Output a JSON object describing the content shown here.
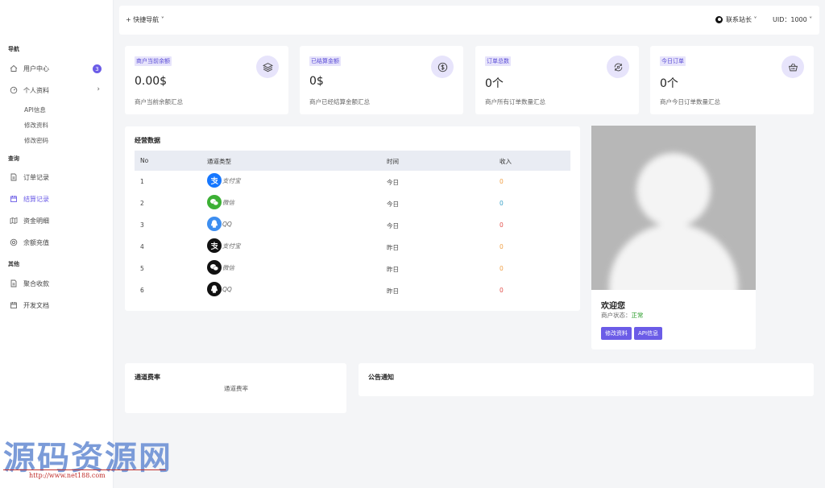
{
  "sidebar": {
    "section_nav": "导航",
    "user_center": "用户中心",
    "user_center_badge": "3",
    "profile": "个人资料",
    "profile_arrow": "›",
    "sub_api": "API信息",
    "sub_edit": "修改资料",
    "sub_pwd": "修改密码",
    "section_query": "查询",
    "orders": "订单记录",
    "settlements": "结算记录",
    "funds": "资金明细",
    "recharge": "余额充值",
    "section_other": "其他",
    "aggregate": "聚合收款",
    "docs": "开发文档"
  },
  "topbar": {
    "quicknav": "+ 快捷导航 ˅",
    "user": "联系站长 ˅",
    "uid": "UID：1000 ˅"
  },
  "stats": [
    {
      "tag": "商户当前余额",
      "value": "0.00$",
      "desc": "商户当前余额汇总",
      "icon": "layers-icon"
    },
    {
      "tag": "已结算金额",
      "value": "0$",
      "desc": "商户已经结算金额汇总",
      "icon": "dollar-coin-icon"
    },
    {
      "tag": "订单总数",
      "value": "0个",
      "desc": "商户所有订单数量汇总",
      "icon": "refresh-cycle-icon"
    },
    {
      "tag": "今日订单",
      "value": "0个",
      "desc": "商户今日订单数量汇总",
      "icon": "basket-icon"
    }
  ],
  "operations": {
    "title": "经营数据",
    "headers": {
      "no": "No",
      "channel": "通道类型",
      "time": "时间",
      "income": "收入"
    },
    "rows": [
      {
        "no": "1",
        "channel": "支付宝",
        "time": "今日",
        "income": "0",
        "kind": "alipay",
        "color": "#1677ff",
        "income_color": "#f0a046"
      },
      {
        "no": "2",
        "channel": "微信",
        "time": "今日",
        "income": "0",
        "kind": "wechat",
        "color": "#3cb034",
        "income_color": "#3aa2c8"
      },
      {
        "no": "3",
        "channel": "QQ",
        "time": "今日",
        "income": "0",
        "kind": "qq",
        "color": "#3d8ef0",
        "income_color": "#e2504c"
      },
      {
        "no": "4",
        "channel": "支付宝",
        "time": "昨日",
        "income": "0",
        "kind": "alipay",
        "color": "#111111",
        "income_color": "#f0a046"
      },
      {
        "no": "5",
        "channel": "微信",
        "time": "昨日",
        "income": "0",
        "kind": "wechat",
        "color": "#111111",
        "income_color": "#f0a046"
      },
      {
        "no": "6",
        "channel": "QQ",
        "time": "昨日",
        "income": "0",
        "kind": "qq",
        "color": "#111111",
        "income_color": "#e2504c"
      }
    ]
  },
  "profile": {
    "welcome": "欢迎您",
    "status_label": "商户状态：",
    "status_value": "正常",
    "btn_edit": "修改资料",
    "btn_api": "API信息"
  },
  "rates": {
    "title": "通道费率",
    "content": "通道费率"
  },
  "notice": {
    "title": "公告通知"
  },
  "watermark": {
    "text": "源码资源网",
    "url": "http://www.net188.com"
  },
  "colors": {
    "accent": "#6b5ce7",
    "accent_light": "#e7e4fb",
    "ok": "#2a9d2a"
  }
}
